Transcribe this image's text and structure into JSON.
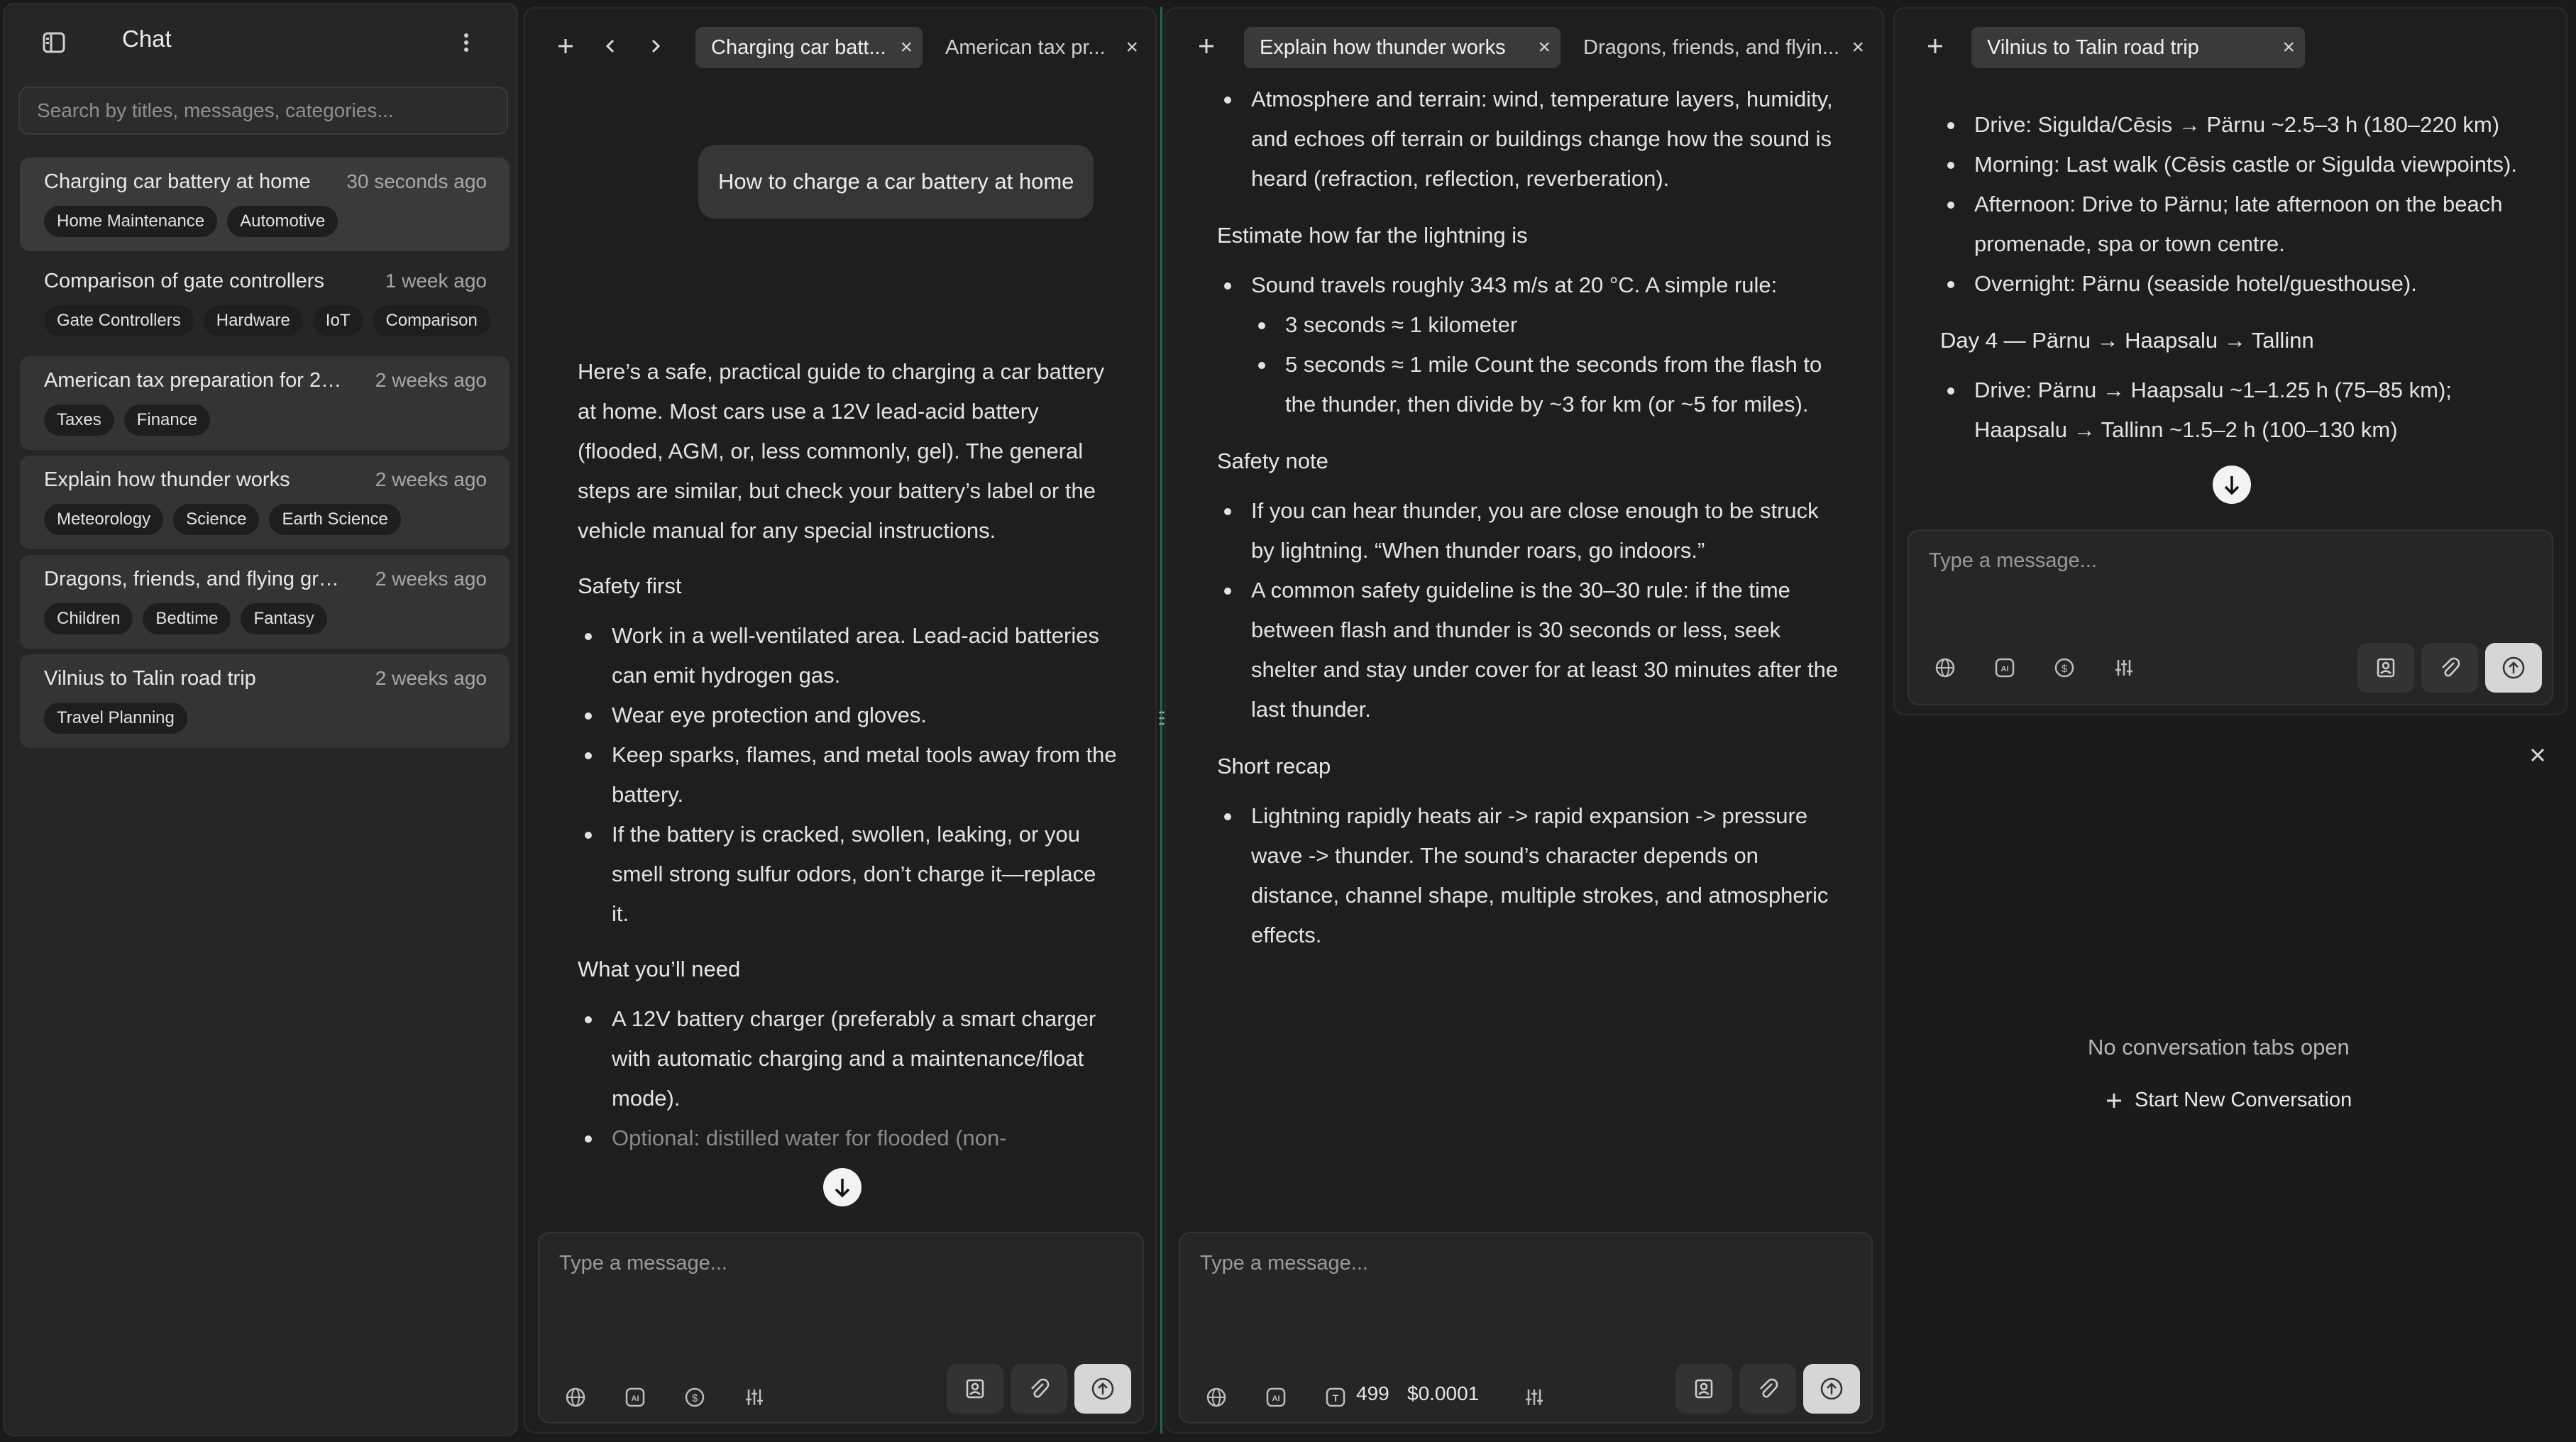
{
  "sidebar": {
    "title": "Chat",
    "search_placeholder": "Search by titles, messages, categories...",
    "conversations": [
      {
        "title": "Charging car battery at home",
        "time": "30 seconds ago",
        "tags": [
          "Home Maintenance",
          "Automotive"
        ]
      },
      {
        "title": "Comparison of gate controllers",
        "time": "1 week ago",
        "tags": [
          "Gate Controllers",
          "Hardware",
          "IoT",
          "Comparison"
        ]
      },
      {
        "title": "American tax preparation for 20...",
        "time": "2 weeks ago",
        "tags": [
          "Taxes",
          "Finance"
        ]
      },
      {
        "title": "Explain how thunder works",
        "time": "2 weeks ago",
        "tags": [
          "Meteorology",
          "Science",
          "Earth Science"
        ]
      },
      {
        "title": "Dragons, friends, and flying gryff...",
        "time": "2 weeks ago",
        "tags": [
          "Children",
          "Bedtime",
          "Fantasy"
        ]
      },
      {
        "title": "Vilnius to Talin road trip",
        "time": "2 weeks ago",
        "tags": [
          "Travel Planning"
        ]
      }
    ]
  },
  "panel1": {
    "tabs": [
      {
        "label": "Charging car batt..."
      },
      {
        "label": "American tax pr..."
      }
    ],
    "user_message": "How to charge a car battery at home",
    "intro": "Here’s a safe, practical guide to charging a car battery at home. Most cars use a 12V lead-acid battery (flooded, AGM, or, less commonly, gel). The general steps are similar, but check your battery’s label or the vehicle manual for any special instructions.",
    "safety_heading": "Safety first",
    "safety_items": [
      "Work in a well-ventilated area. Lead-acid batteries can emit hydrogen gas.",
      "Wear eye protection and gloves.",
      "Keep sparks, flames, and metal tools away from the battery.",
      "If the battery is cracked, swollen, leaking, or you smell strong sulfur odors, don’t charge it—replace it."
    ],
    "need_heading": "What you’ll need",
    "need_items": [
      "A 12V battery charger (preferably a smart charger with automatic charging and a maintenance/float mode).",
      "Optional: distilled water for flooded (non-"
    ],
    "composer_placeholder": "Type a message..."
  },
  "panel2": {
    "tabs": [
      {
        "label": "Explain how thunder works"
      },
      {
        "label": "Dragons, friends, and flyin..."
      }
    ],
    "item_atmosphere": "Atmosphere and terrain: wind, temperature layers, humidity, and echoes off terrain or buildings change how the sound is heard (refraction, reflection, reverberation).",
    "estimate_heading": "Estimate how far the lightning is",
    "estimate_item": "Sound travels roughly 343 m/s at 20 °C. A simple rule:",
    "estimate_sub": [
      "3 seconds ≈ 1 kilometer",
      "5 seconds ≈ 1 mile Count the seconds from the flash to the thunder, then divide by ~3 for km (or ~5 for miles)."
    ],
    "safety_heading": "Safety note",
    "safety_items": [
      "If you can hear thunder, you are close enough to be struck by lightning. “When thunder roars, go indoors.”",
      "A common safety guideline is the 30–30 rule: if the time between flash and thunder is 30 seconds or less, seek shelter and stay under cover for at least 30 minutes after the last thunder."
    ],
    "recap_heading": "Short recap",
    "recap_items": [
      "Lightning rapidly heats air -> rapid expansion -> pressure wave -> thunder. The sound’s character depends on distance, channel shape, multiple strokes, and atmospheric effects."
    ],
    "composer_placeholder": "Type a message...",
    "token_count": "499",
    "cost": "$0.0001"
  },
  "panel3": {
    "tabs": [
      {
        "label": "Vilnius to Talin road trip"
      }
    ],
    "items_a": [
      "Drive: Sigulda/Cēsis → Pärnu ~2.5–3 h (180–220 km)",
      "Morning: Last walk (Cēsis castle or Sigulda viewpoints).",
      "Afternoon: Drive to Pärnu; late afternoon on the beach promenade, spa or town centre.",
      "Overnight: Pärnu (seaside hotel/guesthouse)."
    ],
    "day4_heading": "Day 4 — Pärnu → Haapsalu → Tallinn",
    "day4_items": [
      "Drive: Pärnu → Haapsalu ~1–1.25 h (75–85 km); Haapsalu → Tallinn ~1.5–2 h (100–130 km)"
    ],
    "composer_placeholder": "Type a message..."
  },
  "empty_state": {
    "text": "No conversation tabs open",
    "start_label": "Start New Conversation"
  },
  "colors": {
    "background": "#1b1b1b",
    "panel": "#1e1e1e",
    "sidebar": "#262626",
    "accent_divider": "#1f6a4f"
  }
}
